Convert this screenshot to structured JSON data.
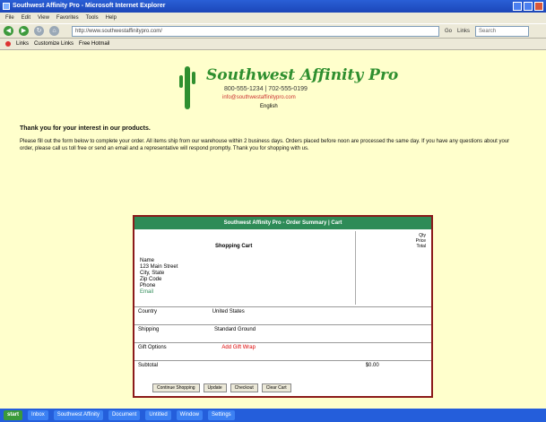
{
  "window": {
    "title": "Southwest Affinity Pro - Microsoft Internet Explorer"
  },
  "menu": [
    "File",
    "Edit",
    "View",
    "Favorites",
    "Tools",
    "Help"
  ],
  "toolbar": {
    "address": "http://www.southwestaffinitypro.com/",
    "go_label": "Go",
    "links_label": "Links",
    "search_placeholder": "Search"
  },
  "links": {
    "items": [
      "Links",
      "Customize Links",
      "Free Hotmail"
    ]
  },
  "site": {
    "brand": "Southwest Affinity Pro",
    "phone": "800-555-1234 | 702-555-0199",
    "email": "info@southwestaffinitypro.com",
    "language": "English"
  },
  "notice": "Thank you for your interest in our products.",
  "paragraph": "Please fill out the form below to complete your order. All items ship from our warehouse within 2 business days. Orders placed before noon are processed the same day. If you have any questions about your order, please call us toll free or send an email and a representative will respond promptly. Thank you for shopping with us.",
  "panel": {
    "header": "Southwest Affinity Pro - Order Summary | Cart",
    "cart_title": "Shopping Cart",
    "cart_cols": [
      "Qty",
      "Price",
      "Total"
    ],
    "address": [
      "Name",
      "123 Main Street",
      "City, State",
      "Zip Code",
      "Phone",
      "Email"
    ],
    "rows": [
      {
        "label": "Country",
        "value": "United States"
      },
      {
        "label": "Shipping",
        "value": "Standard Ground"
      },
      {
        "label": "Gift Options",
        "value": "Add Gift Wrap"
      },
      {
        "label": "Subtotal",
        "value": "$0.00"
      }
    ],
    "buttons": [
      "Continue Shopping",
      "Update",
      "Checkout",
      "Clear Cart"
    ]
  },
  "taskbar": [
    "start",
    "Inbox",
    "Southwest Affinity",
    "Document",
    "Untitled",
    "Window",
    "Settings"
  ]
}
